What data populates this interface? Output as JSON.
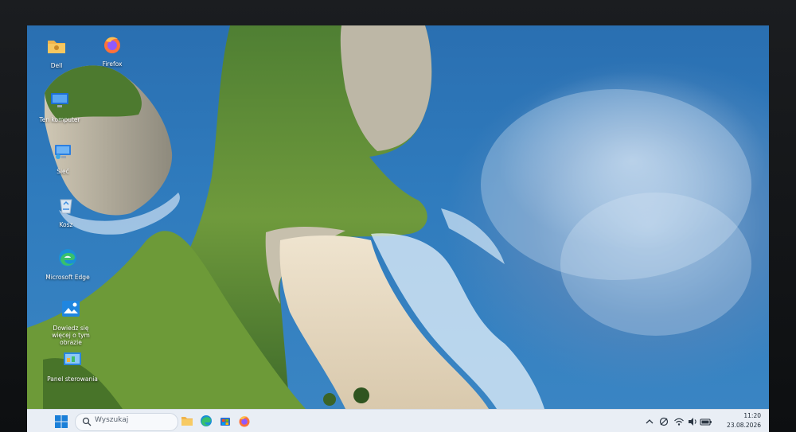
{
  "desktop": {
    "icons": [
      {
        "label": "Dell",
        "icon": "folder-icon"
      },
      {
        "label": "Firefox",
        "icon": "firefox-icon"
      },
      {
        "label": "Ten komputer",
        "icon": "monitor-icon"
      },
      {
        "label": "Sieć",
        "icon": "network-icon"
      },
      {
        "label": "Kosz",
        "icon": "recycle-bin-icon"
      },
      {
        "label": "Microsoft Edge",
        "icon": "edge-icon"
      },
      {
        "label": "Dowiedz się więcej o tym obrazie",
        "icon": "picture-icon"
      },
      {
        "label": "Panel sterowania",
        "icon": "control-panel-icon"
      }
    ]
  },
  "taskbar": {
    "search_placeholder": "Wyszukaj",
    "pinned": [
      "file-explorer-icon",
      "edge-icon",
      "store-icon",
      "firefox-icon"
    ],
    "tray_icons": [
      "chevron-up-icon",
      "notification-icon",
      "wifi-icon",
      "volume-icon",
      "battery-icon"
    ],
    "time": "11:20",
    "date": "23.08.2026"
  },
  "colors": {
    "taskbar": "#e9eef5",
    "ocean": "#2f7bbd",
    "cliff": "#5e8c35",
    "sand": "#e8dcc6"
  }
}
